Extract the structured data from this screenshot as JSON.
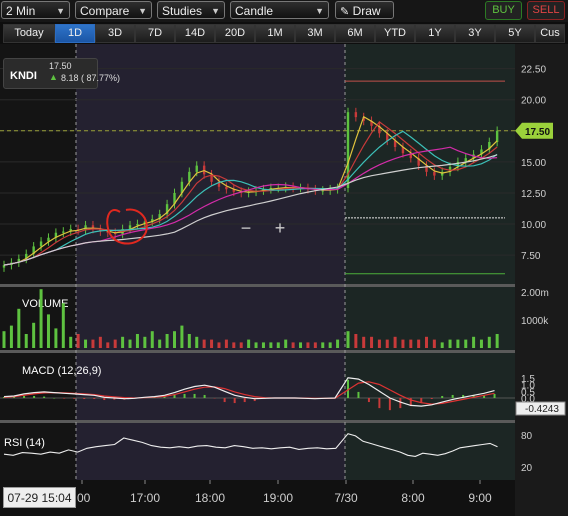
{
  "toolbar": {
    "interval": "2 Min",
    "compare": "Compare",
    "studies": "Studies",
    "chart_style": "Candle",
    "draw": "Draw",
    "buy": "BUY",
    "sell": "SELL"
  },
  "ranges": [
    "Today",
    "1D",
    "3D",
    "7D",
    "14D",
    "20D",
    "1M",
    "3M",
    "6M",
    "YTD",
    "1Y",
    "3Y",
    "5Y",
    "Cus"
  ],
  "active_range": "1D",
  "quote": {
    "symbol": "KNDI",
    "last": "17.50",
    "change": "8.18 ( 87.77%)",
    "direction": "up"
  },
  "zoom": {
    "minus": "−",
    "plus": "+"
  },
  "cursor_date": "07-29 15:04",
  "colors": {
    "up": "#5ec240",
    "down": "#c83a3a",
    "last_price_tag": "#9bd13b",
    "background": "#111111",
    "active_range": "#2f74c9"
  },
  "chart_data": [
    {
      "type": "candlestick",
      "title": "KNDI",
      "sessions": [
        "07-29",
        "7/30"
      ],
      "x_ticks": [
        ":00",
        "17:00",
        "18:00",
        "19:00",
        "7/30",
        "8:00",
        "9:00"
      ],
      "y_ticks": [
        "22.50",
        "20.00",
        "17.50",
        "15.00",
        "12.50",
        "10.00",
        "7.50"
      ],
      "ylim": [
        5.5,
        24.0
      ],
      "last_price": "17.50",
      "close": [
        6.7,
        6.9,
        7.2,
        7.6,
        8.2,
        8.6,
        8.9,
        9.3,
        9.4,
        9.6,
        9.5,
        9.9,
        9.6,
        9.4,
        9.3,
        9.2,
        9.6,
        9.9,
        10.0,
        10.2,
        10.4,
        10.8,
        11.6,
        12.5,
        13.4,
        14.2,
        14.7,
        14.0,
        13.4,
        13.0,
        12.8,
        12.6,
        12.5,
        12.6,
        12.7,
        12.8,
        12.9,
        12.9,
        13.0,
        12.9,
        12.9,
        12.8,
        12.7,
        12.7,
        12.8,
        12.9,
        19.0,
        18.6,
        18.3,
        17.9,
        17.3,
        16.7,
        16.2,
        15.7,
        15.3,
        14.7,
        14.2,
        13.9,
        14.2,
        14.6,
        15.0,
        15.3,
        15.6,
        16.0,
        16.6,
        17.5
      ],
      "series": [
        {
          "name": "SMA fast",
          "color": "#e0c33d"
        },
        {
          "name": "SMA mid",
          "color": "#c83a3a"
        },
        {
          "name": "SMA slow",
          "color": "#3cc0b8"
        },
        {
          "name": "SMA long",
          "color": "#d32ca9"
        },
        {
          "name": "SMA longest",
          "color": "#cfcfcf"
        }
      ]
    },
    {
      "type": "bar",
      "title": "VOLUME",
      "y_ticks": [
        "2.00m",
        "1000k"
      ],
      "values": [
        0.6,
        0.8,
        1.4,
        0.5,
        0.9,
        2.1,
        1.2,
        0.7,
        1.6,
        0.4,
        0.5,
        0.3,
        0.3,
        0.4,
        0.2,
        0.3,
        0.4,
        0.3,
        0.5,
        0.4,
        0.6,
        0.3,
        0.5,
        0.6,
        0.8,
        0.5,
        0.4,
        0.3,
        0.3,
        0.2,
        0.3,
        0.2,
        0.2,
        0.3,
        0.2,
        0.2,
        0.2,
        0.2,
        0.3,
        0.2,
        0.2,
        0.2,
        0.2,
        0.2,
        0.2,
        0.3,
        0.6,
        0.5,
        0.4,
        0.4,
        0.3,
        0.3,
        0.4,
        0.3,
        0.3,
        0.3,
        0.4,
        0.3,
        0.2,
        0.3,
        0.3,
        0.3,
        0.4,
        0.3,
        0.4,
        0.5
      ]
    },
    {
      "type": "line",
      "title": "MACD (12,26,9)",
      "y_ticks": [
        "1.5",
        "1.0",
        "0.5",
        "0.0"
      ],
      "last_value": "-0.4243",
      "macd": [
        0.1,
        0.15,
        0.3,
        0.4,
        0.45,
        0.4,
        0.35,
        0.3,
        0.25,
        0.2,
        0.05,
        0.0,
        -0.05,
        -0.02,
        0.05,
        0.1,
        0.2,
        0.4,
        0.65,
        0.85,
        0.95,
        0.8,
        0.5,
        0.2,
        0.05,
        -0.05,
        -0.02,
        0.0,
        0.0,
        0.0,
        -0.02,
        -0.05,
        -0.02,
        0.0,
        1.5,
        1.4,
        1.0,
        0.5,
        0.0,
        -0.3,
        -0.55,
        -0.6,
        -0.5,
        -0.3,
        -0.1,
        0.05,
        0.2,
        0.35,
        0.55
      ],
      "signal": [
        0.05,
        0.1,
        0.2,
        0.3,
        0.38,
        0.4,
        0.38,
        0.34,
        0.3,
        0.25,
        0.15,
        0.08,
        0.03,
        0.0,
        0.02,
        0.06,
        0.12,
        0.25,
        0.45,
        0.65,
        0.8,
        0.82,
        0.7,
        0.45,
        0.25,
        0.1,
        0.02,
        0.0,
        0.0,
        0.0,
        -0.01,
        -0.03,
        -0.03,
        -0.02,
        0.6,
        1.1,
        1.2,
        1.0,
        0.6,
        0.2,
        -0.15,
        -0.35,
        -0.45,
        -0.4,
        -0.25,
        -0.1,
        0.05,
        0.2,
        0.35
      ]
    },
    {
      "type": "line",
      "title": "RSI (14)",
      "y_ticks": [
        "80",
        "20"
      ],
      "values": [
        44,
        42,
        47,
        46,
        44,
        48,
        46,
        52,
        48,
        55,
        58,
        60,
        62,
        74,
        70,
        66,
        60,
        57,
        56,
        58,
        56,
        59,
        60,
        57,
        56,
        60,
        58,
        55,
        56,
        54,
        56,
        57,
        53,
        55,
        56,
        54,
        55,
        82,
        78,
        68,
        64,
        60,
        56,
        52,
        48,
        42,
        40,
        46,
        44,
        42,
        45,
        50,
        56,
        58,
        60,
        62,
        64,
        58
      ]
    }
  ]
}
